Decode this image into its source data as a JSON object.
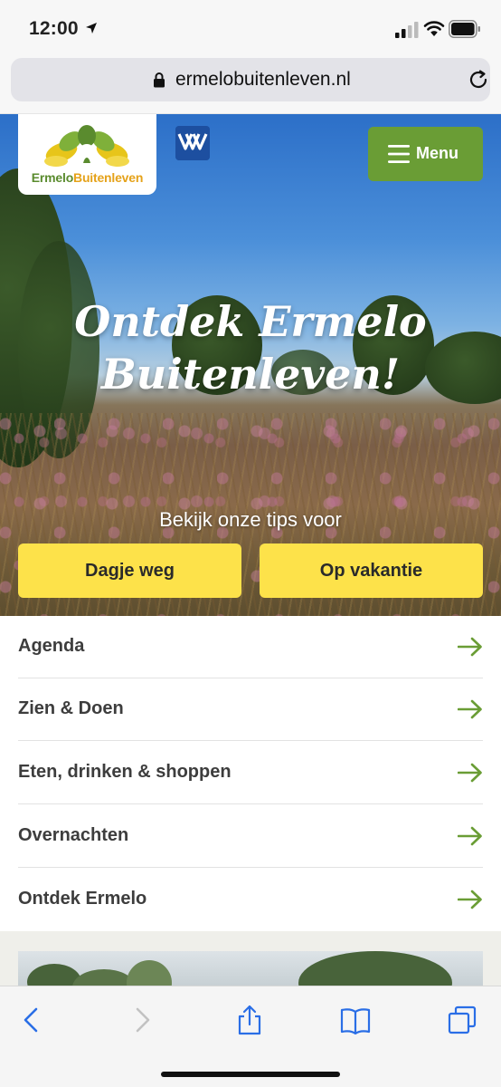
{
  "status_bar": {
    "time": "12:00"
  },
  "browser": {
    "url": "ermelobuitenleven.nl"
  },
  "header": {
    "logo_word1": "Ermelo",
    "logo_word2": "Buitenleven",
    "menu_label": "Menu"
  },
  "hero": {
    "title_line1": "Ontdek Ermelo",
    "title_line2": "Buitenleven!",
    "subtitle": "Bekijk onze tips voor",
    "buttons": [
      {
        "label": "Dagje weg"
      },
      {
        "label": "Op vakantie"
      }
    ]
  },
  "nav": {
    "items": [
      {
        "label": "Agenda"
      },
      {
        "label": "Zien & Doen"
      },
      {
        "label": "Eten, drinken & shoppen"
      },
      {
        "label": "Overnachten"
      },
      {
        "label": "Ontdek Ermelo"
      }
    ]
  },
  "colors": {
    "brand_green": "#6a9d35",
    "cta_yellow": "#fde24a",
    "arrow_green": "#6a9d35",
    "vvv_blue": "#1d4fa0"
  },
  "icons": [
    "location-arrow-icon",
    "signal-icon",
    "wifi-icon",
    "battery-icon",
    "lock-icon",
    "reload-icon",
    "hamburger-icon",
    "arrow-right-icon",
    "back-icon",
    "forward-icon",
    "share-icon",
    "bookmarks-icon",
    "tabs-icon"
  ]
}
